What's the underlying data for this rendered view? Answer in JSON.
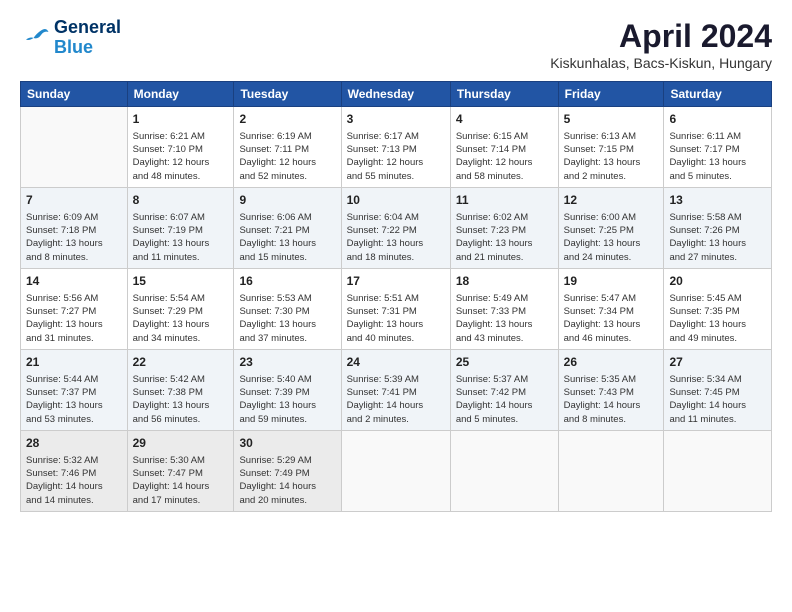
{
  "header": {
    "logo_line1": "General",
    "logo_line2": "Blue",
    "title": "April 2024",
    "subtitle": "Kiskunhalas, Bacs-Kiskun, Hungary"
  },
  "days_of_week": [
    "Sunday",
    "Monday",
    "Tuesday",
    "Wednesday",
    "Thursday",
    "Friday",
    "Saturday"
  ],
  "weeks": [
    [
      {
        "day": "",
        "info": ""
      },
      {
        "day": "1",
        "info": "Sunrise: 6:21 AM\nSunset: 7:10 PM\nDaylight: 12 hours\nand 48 minutes."
      },
      {
        "day": "2",
        "info": "Sunrise: 6:19 AM\nSunset: 7:11 PM\nDaylight: 12 hours\nand 52 minutes."
      },
      {
        "day": "3",
        "info": "Sunrise: 6:17 AM\nSunset: 7:13 PM\nDaylight: 12 hours\nand 55 minutes."
      },
      {
        "day": "4",
        "info": "Sunrise: 6:15 AM\nSunset: 7:14 PM\nDaylight: 12 hours\nand 58 minutes."
      },
      {
        "day": "5",
        "info": "Sunrise: 6:13 AM\nSunset: 7:15 PM\nDaylight: 13 hours\nand 2 minutes."
      },
      {
        "day": "6",
        "info": "Sunrise: 6:11 AM\nSunset: 7:17 PM\nDaylight: 13 hours\nand 5 minutes."
      }
    ],
    [
      {
        "day": "7",
        "info": "Sunrise: 6:09 AM\nSunset: 7:18 PM\nDaylight: 13 hours\nand 8 minutes."
      },
      {
        "day": "8",
        "info": "Sunrise: 6:07 AM\nSunset: 7:19 PM\nDaylight: 13 hours\nand 11 minutes."
      },
      {
        "day": "9",
        "info": "Sunrise: 6:06 AM\nSunset: 7:21 PM\nDaylight: 13 hours\nand 15 minutes."
      },
      {
        "day": "10",
        "info": "Sunrise: 6:04 AM\nSunset: 7:22 PM\nDaylight: 13 hours\nand 18 minutes."
      },
      {
        "day": "11",
        "info": "Sunrise: 6:02 AM\nSunset: 7:23 PM\nDaylight: 13 hours\nand 21 minutes."
      },
      {
        "day": "12",
        "info": "Sunrise: 6:00 AM\nSunset: 7:25 PM\nDaylight: 13 hours\nand 24 minutes."
      },
      {
        "day": "13",
        "info": "Sunrise: 5:58 AM\nSunset: 7:26 PM\nDaylight: 13 hours\nand 27 minutes."
      }
    ],
    [
      {
        "day": "14",
        "info": "Sunrise: 5:56 AM\nSunset: 7:27 PM\nDaylight: 13 hours\nand 31 minutes."
      },
      {
        "day": "15",
        "info": "Sunrise: 5:54 AM\nSunset: 7:29 PM\nDaylight: 13 hours\nand 34 minutes."
      },
      {
        "day": "16",
        "info": "Sunrise: 5:53 AM\nSunset: 7:30 PM\nDaylight: 13 hours\nand 37 minutes."
      },
      {
        "day": "17",
        "info": "Sunrise: 5:51 AM\nSunset: 7:31 PM\nDaylight: 13 hours\nand 40 minutes."
      },
      {
        "day": "18",
        "info": "Sunrise: 5:49 AM\nSunset: 7:33 PM\nDaylight: 13 hours\nand 43 minutes."
      },
      {
        "day": "19",
        "info": "Sunrise: 5:47 AM\nSunset: 7:34 PM\nDaylight: 13 hours\nand 46 minutes."
      },
      {
        "day": "20",
        "info": "Sunrise: 5:45 AM\nSunset: 7:35 PM\nDaylight: 13 hours\nand 49 minutes."
      }
    ],
    [
      {
        "day": "21",
        "info": "Sunrise: 5:44 AM\nSunset: 7:37 PM\nDaylight: 13 hours\nand 53 minutes."
      },
      {
        "day": "22",
        "info": "Sunrise: 5:42 AM\nSunset: 7:38 PM\nDaylight: 13 hours\nand 56 minutes."
      },
      {
        "day": "23",
        "info": "Sunrise: 5:40 AM\nSunset: 7:39 PM\nDaylight: 13 hours\nand 59 minutes."
      },
      {
        "day": "24",
        "info": "Sunrise: 5:39 AM\nSunset: 7:41 PM\nDaylight: 14 hours\nand 2 minutes."
      },
      {
        "day": "25",
        "info": "Sunrise: 5:37 AM\nSunset: 7:42 PM\nDaylight: 14 hours\nand 5 minutes."
      },
      {
        "day": "26",
        "info": "Sunrise: 5:35 AM\nSunset: 7:43 PM\nDaylight: 14 hours\nand 8 minutes."
      },
      {
        "day": "27",
        "info": "Sunrise: 5:34 AM\nSunset: 7:45 PM\nDaylight: 14 hours\nand 11 minutes."
      }
    ],
    [
      {
        "day": "28",
        "info": "Sunrise: 5:32 AM\nSunset: 7:46 PM\nDaylight: 14 hours\nand 14 minutes."
      },
      {
        "day": "29",
        "info": "Sunrise: 5:30 AM\nSunset: 7:47 PM\nDaylight: 14 hours\nand 17 minutes."
      },
      {
        "day": "30",
        "info": "Sunrise: 5:29 AM\nSunset: 7:49 PM\nDaylight: 14 hours\nand 20 minutes."
      },
      {
        "day": "",
        "info": ""
      },
      {
        "day": "",
        "info": ""
      },
      {
        "day": "",
        "info": ""
      },
      {
        "day": "",
        "info": ""
      }
    ]
  ]
}
